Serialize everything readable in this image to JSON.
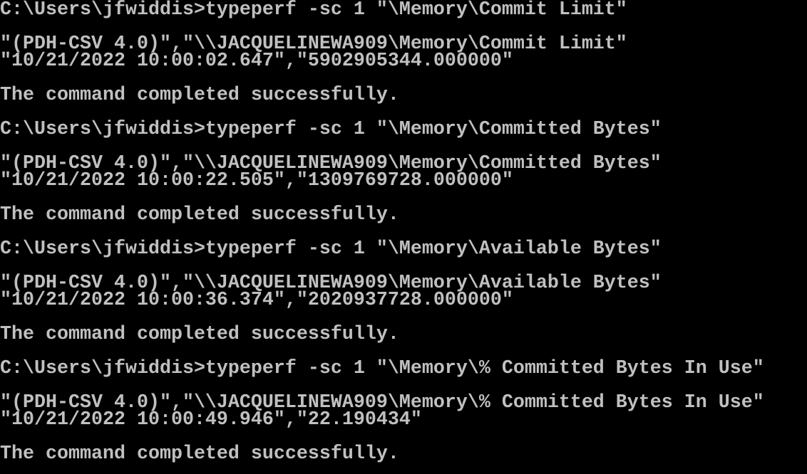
{
  "terminal": {
    "text_color": "#c0c0c0",
    "background_color": "#000000",
    "lines": [
      "C:\\Users\\jfwiddis>typeperf -sc 1 \"\\Memory\\Commit Limit\"",
      "",
      "\"(PDH-CSV 4.0)\",\"\\\\JACQUELINEWA909\\Memory\\Commit Limit\"",
      "\"10/21/2022 10:00:02.647\",\"5902905344.000000\"",
      "",
      "The command completed successfully.",
      "",
      "C:\\Users\\jfwiddis>typeperf -sc 1 \"\\Memory\\Committed Bytes\"",
      "",
      "\"(PDH-CSV 4.0)\",\"\\\\JACQUELINEWA909\\Memory\\Committed Bytes\"",
      "\"10/21/2022 10:00:22.505\",\"1309769728.000000\"",
      "",
      "The command completed successfully.",
      "",
      "C:\\Users\\jfwiddis>typeperf -sc 1 \"\\Memory\\Available Bytes\"",
      "",
      "\"(PDH-CSV 4.0)\",\"\\\\JACQUELINEWA909\\Memory\\Available Bytes\"",
      "\"10/21/2022 10:00:36.374\",\"2020937728.000000\"",
      "",
      "The command completed successfully.",
      "",
      "C:\\Users\\jfwiddis>typeperf -sc 1 \"\\Memory\\% Committed Bytes In Use\"",
      "",
      "\"(PDH-CSV 4.0)\",\"\\\\JACQUELINEWA909\\Memory\\% Committed Bytes In Use\"",
      "\"10/21/2022 10:00:49.946\",\"22.190434\"",
      "",
      "The command completed successfully."
    ]
  }
}
